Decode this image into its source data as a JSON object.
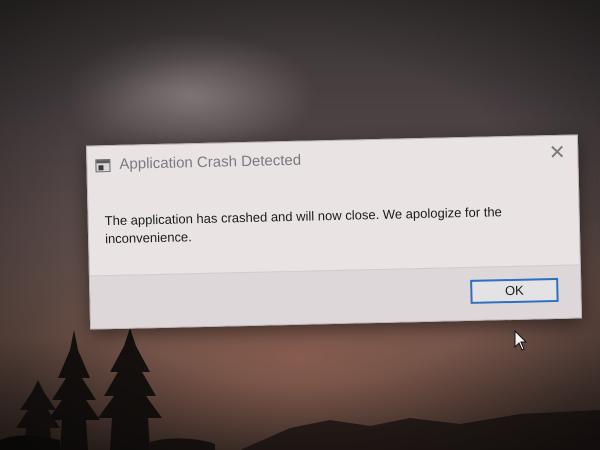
{
  "dialog": {
    "title": "Application Crash Detected",
    "message": "The application has crashed and will now close. We apologize for the inconvenience.",
    "ok_label": "OK",
    "close_glyph": "✕",
    "icon": "application-window-icon"
  },
  "colors": {
    "dialog_bg": "#e9e3e4",
    "footer_bg": "#ddd7d9",
    "ok_border": "#2f6fbf"
  }
}
